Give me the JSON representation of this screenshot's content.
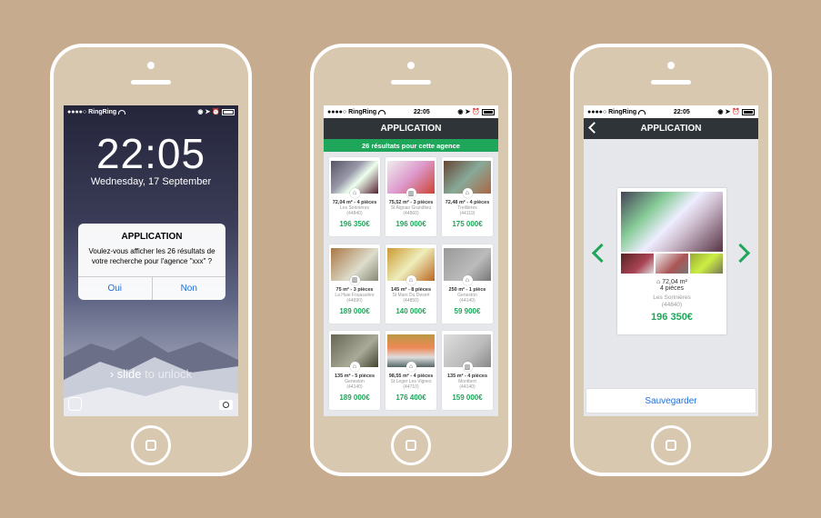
{
  "status": {
    "carrier": "●●●●○ RingRing",
    "time": "22:05",
    "icons": "◉ ➤ ⏰"
  },
  "lock": {
    "time": "22:05",
    "date": "Wednesday, 17 September",
    "alert": {
      "title": "APPLICATION",
      "message": "Voulez-vous afficher les 26 résultats de votre recherche pour l'agence \"xxx\" ?",
      "yes": "Oui",
      "no": "Non"
    },
    "slide_prefix": "› slide",
    "slide_suffix": "to unlock"
  },
  "app": {
    "title": "APPLICATION"
  },
  "list": {
    "banner": "26 résultats pour cette agence",
    "items": [
      {
        "title": "72,04 m² - 4 pièces",
        "location": "Les Sorinières",
        "zip": "(44840)",
        "price": "196 350€",
        "icon": "⌂"
      },
      {
        "title": "75,52 m² - 3 pièces",
        "location": "St Aignan Grandlieu",
        "zip": "(44860)",
        "price": "196 000€",
        "icon": "▥"
      },
      {
        "title": "72,48 m² - 4 pièces",
        "location": "Treillières",
        "zip": "(44119)",
        "price": "175 000€",
        "icon": "⌂"
      },
      {
        "title": "75 m² - 3 pièces",
        "location": "La Haie Fouassière",
        "zip": "(44690)",
        "price": "189 000€",
        "icon": "▥"
      },
      {
        "title": "145 m² - 8 pièces",
        "location": "St Mars Du Desert",
        "zip": "(44850)",
        "price": "140 000€",
        "icon": "⌂"
      },
      {
        "title": "250 m² - 1 pièce",
        "location": "Geneston",
        "zip": "(44140)",
        "price": "59 900€",
        "icon": "⌂"
      },
      {
        "title": "135 m² - 5 pièces",
        "location": "Geneston",
        "zip": "(44140)",
        "price": "189 000€",
        "icon": "⌂"
      },
      {
        "title": "98,55 m² - 4 pièces",
        "location": "St Leger Les Vignes",
        "zip": "(44710)",
        "price": "176 400€",
        "icon": "⌂"
      },
      {
        "title": "135 m² - 4 pièces",
        "location": "Montbert",
        "zip": "(44140)",
        "price": "159 000€",
        "icon": "▥"
      }
    ]
  },
  "detail": {
    "area": "⌂ 72,04 m²",
    "rooms": "4 pièces",
    "location": "Les Sorinières",
    "zip": "(44840)",
    "price": "196 350€",
    "save": "Sauvegarder"
  }
}
